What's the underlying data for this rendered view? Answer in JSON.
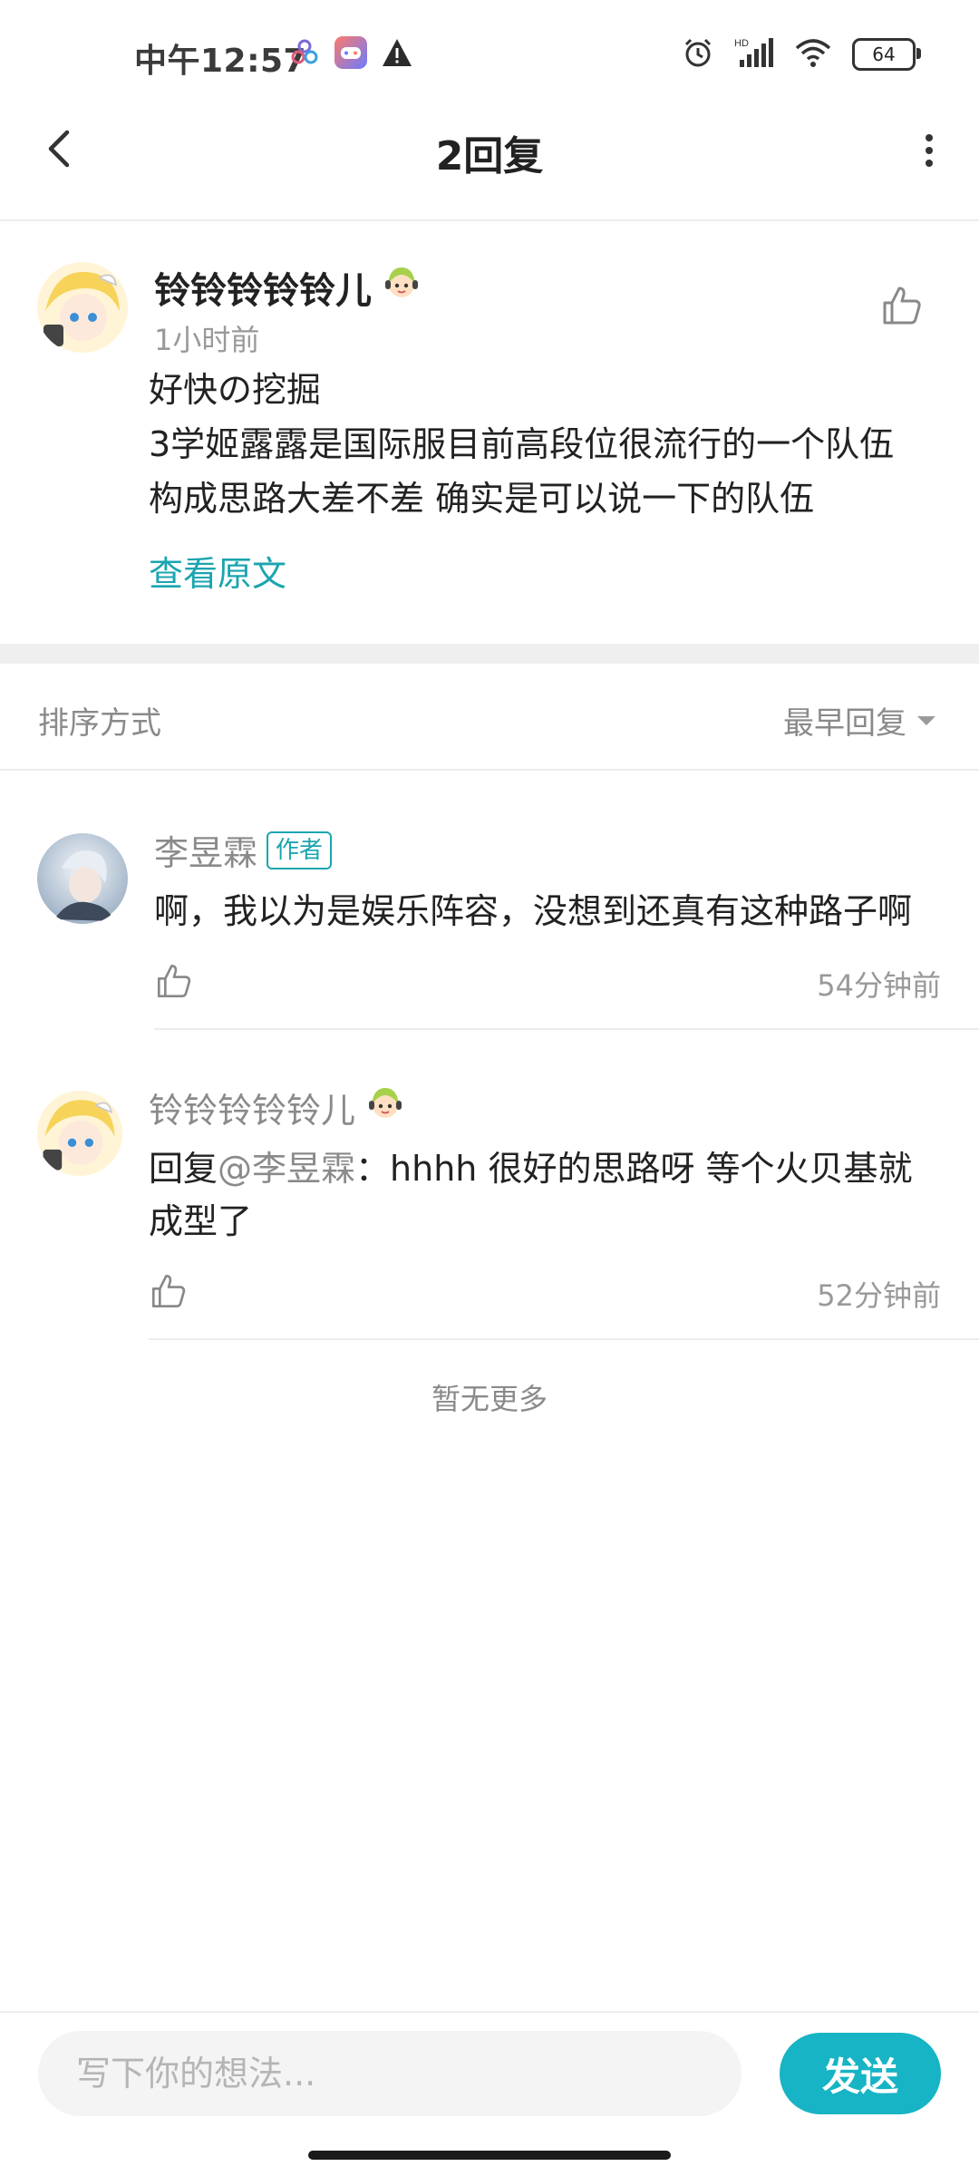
{
  "status_bar": {
    "time": "中午12:57",
    "battery": "64",
    "icons": [
      "app-cluster-icon",
      "game-center-icon",
      "warning-icon",
      "alarm-icon",
      "hd-signal-icon",
      "wifi-icon",
      "battery-icon"
    ]
  },
  "header": {
    "title": "2回复",
    "back_icon": "chevron-left-icon",
    "more_icon": "more-vertical-icon"
  },
  "post": {
    "author": "铃铃铃铃铃儿",
    "time": "1小时前",
    "text": "好快の挖掘\n3学姬露露是国际服目前高段位很流行的一个队伍构成思路大差不差 确实是可以说一下的队伍",
    "view_original": "查看原文"
  },
  "sort": {
    "label": "排序方式",
    "value": "最早回复"
  },
  "replies": [
    {
      "author": "李昱霖",
      "badge": "作者",
      "text": "啊，我以为是娱乐阵容，没想到还真有这种路子啊",
      "time": "54分钟前"
    },
    {
      "author": "铃铃铃铃铃儿",
      "reply_prefix": "回复",
      "mention": "@李昱霖",
      "text": "：hhhh 很好的思路呀 等个火贝基就成型了",
      "time": "52分钟前"
    }
  ],
  "footer_note": "暂无更多",
  "composer": {
    "placeholder": "写下你的想法...",
    "send_label": "发送"
  },
  "colors": {
    "accent": "#16b4c4",
    "link": "#1aa5b0",
    "muted": "#8a8a8a"
  }
}
